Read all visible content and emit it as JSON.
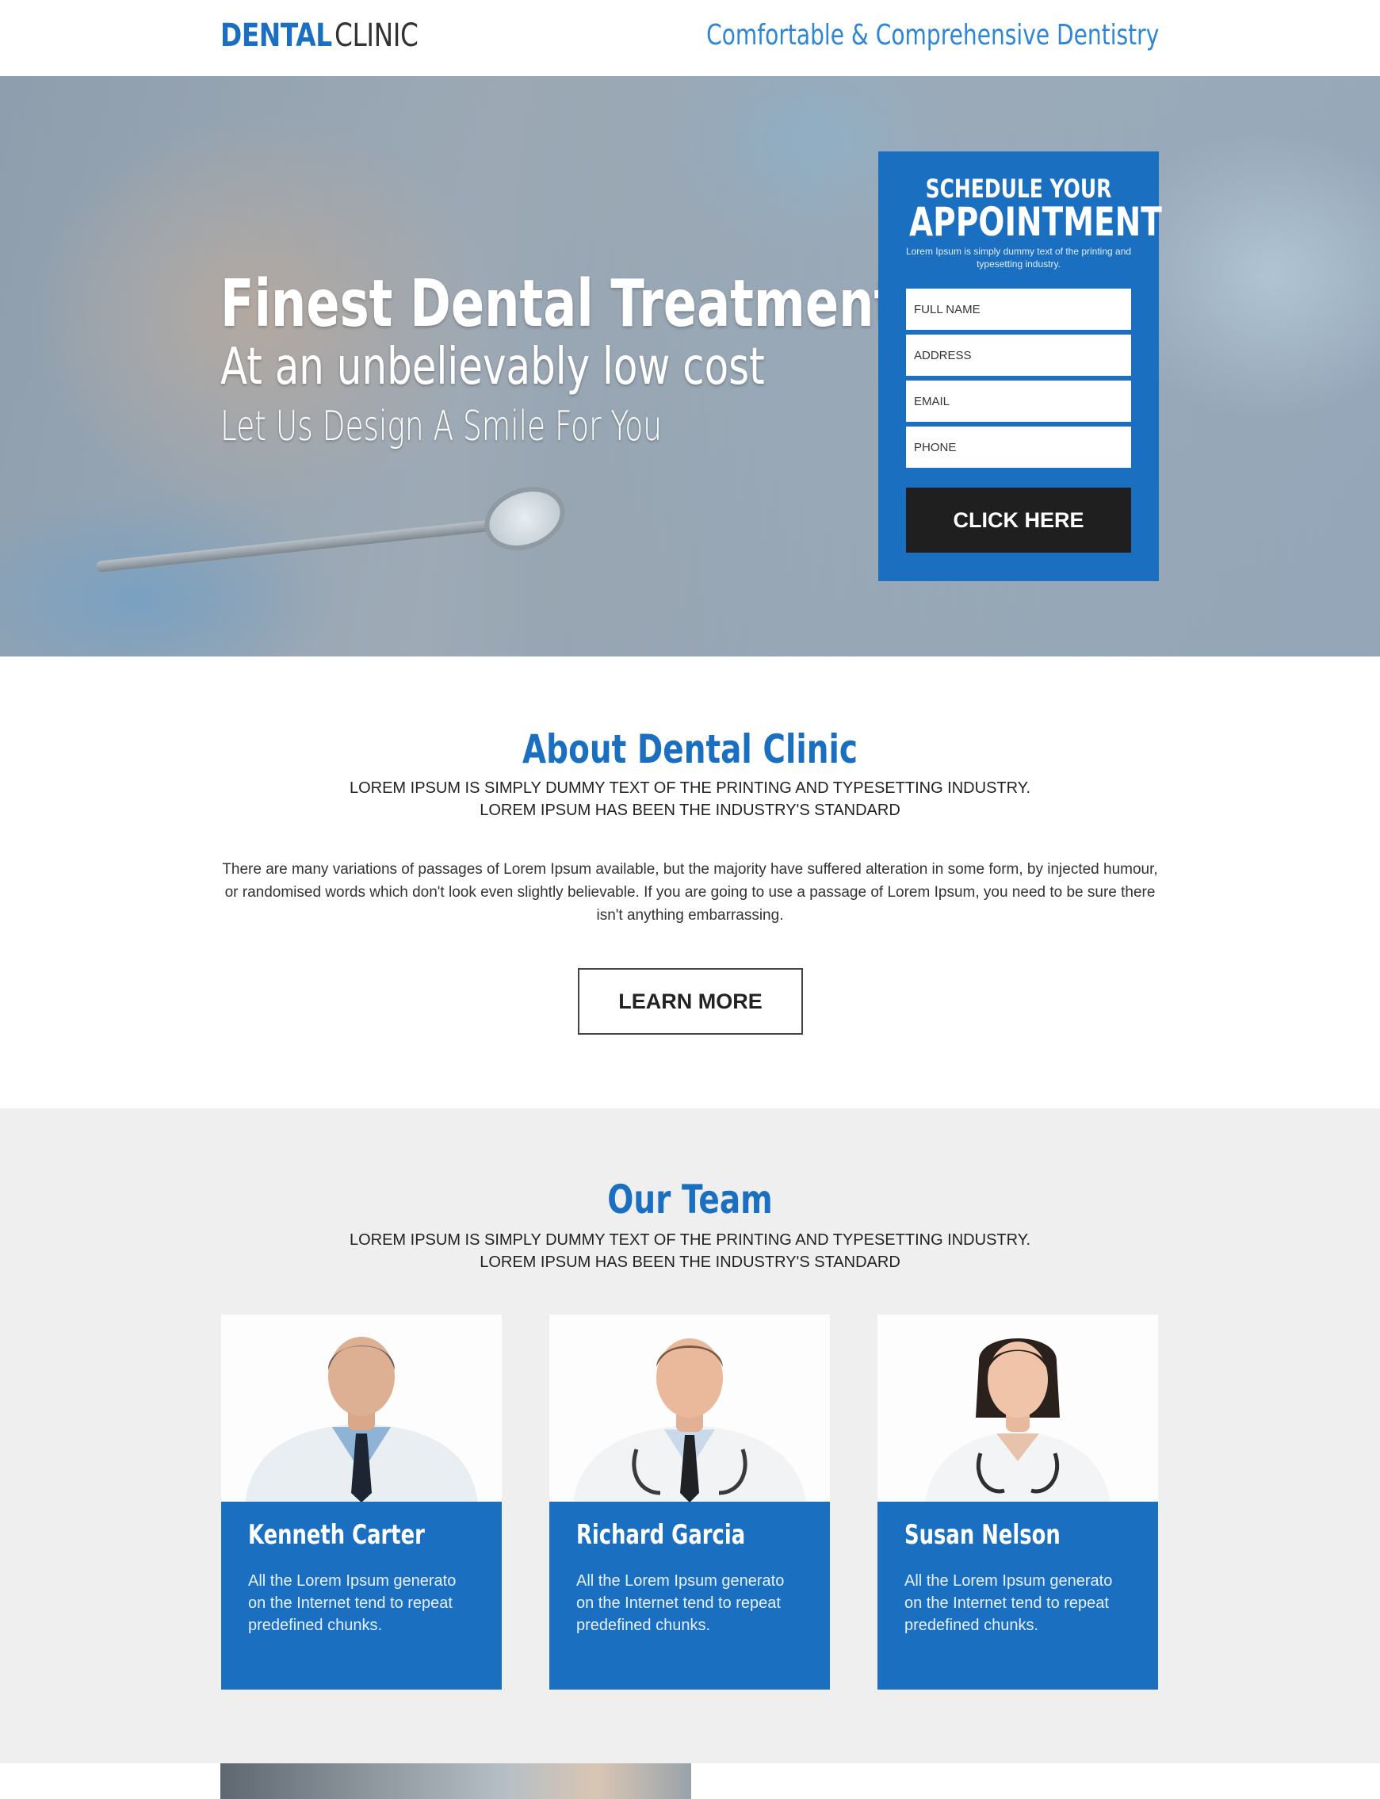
{
  "header": {
    "logo_strong": "DENTAL",
    "logo_light": "CLINIC",
    "tagline": "Comfortable & Comprehensive Dentistry"
  },
  "hero": {
    "headline": "Finest Dental Treatment",
    "subheadline": "At an unbelievably low cost",
    "tagline": "Let Us Design A Smile For You"
  },
  "appointment": {
    "title_small": "SCHEDULE YOUR",
    "title_large": "APPOINTMENT",
    "description": "Lorem Ipsum is simply dummy text of the printing and typesetting industry.",
    "fields": {
      "full_name": "FULL NAME",
      "address": "ADDRESS",
      "email": "EMAIL",
      "phone": "PHONE"
    },
    "submit_label": "CLICK HERE"
  },
  "about": {
    "title": "About Dental Clinic",
    "caps_line_1": "LOREM IPSUM IS SIMPLY DUMMY TEXT OF THE PRINTING AND TYPESETTING INDUSTRY.",
    "caps_line_2": "LOREM IPSUM HAS BEEN THE INDUSTRY'S STANDARD",
    "body": "There are many variations of passages of Lorem Ipsum available, but the majority have suffered alteration in some form, by injected humour, or randomised words which don't look even slightly believable. If you are going to use a passage of Lorem Ipsum, you need to be sure there isn't anything embarrassing.",
    "button_label": "LEARN MORE"
  },
  "team": {
    "title": "Our Team",
    "caps_line_1": "LOREM IPSUM IS SIMPLY DUMMY TEXT OF THE PRINTING AND TYPESETTING INDUSTRY.",
    "caps_line_2": "LOREM IPSUM HAS BEEN THE INDUSTRY'S STANDARD",
    "members": [
      {
        "name": "Kenneth Carter",
        "text": "All the Lorem Ipsum generato on the Internet tend to repeat predefined chunks."
      },
      {
        "name": "Richard Garcia",
        "text": "All the Lorem Ipsum generato on the Internet tend to repeat predefined chunks."
      },
      {
        "name": "Susan Nelson",
        "text": "All the Lorem Ipsum generato on the Internet tend to repeat predefined chunks."
      }
    ]
  },
  "colors": {
    "brand_blue": "#1a6fc0",
    "button_dark": "#1f1f1f",
    "section_gray": "#efefef"
  }
}
